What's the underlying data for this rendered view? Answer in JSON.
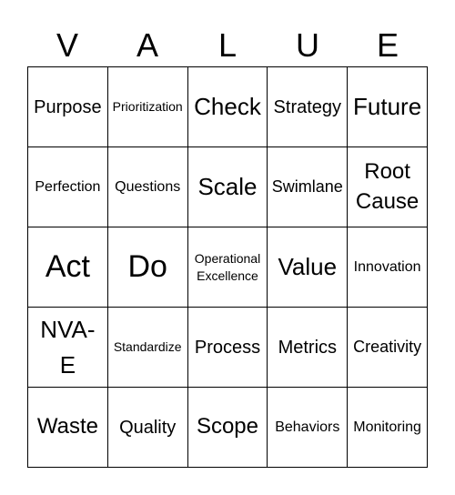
{
  "header": [
    "V",
    "A",
    "L",
    "U",
    "E"
  ],
  "cells": [
    "Purpose",
    "Prioritization",
    "Check",
    "Strategy",
    "Future",
    "Perfection",
    "Questions",
    "Scale",
    "Swimlane",
    "Root Cause",
    "Act",
    "Do",
    "Operational Excellence",
    "Value",
    "Innovation",
    "NVA-E",
    "Standardize",
    "Process",
    "Metrics",
    "Creativity",
    "Waste",
    "Quality",
    "Scope",
    "Behaviors",
    "Monitoring"
  ]
}
